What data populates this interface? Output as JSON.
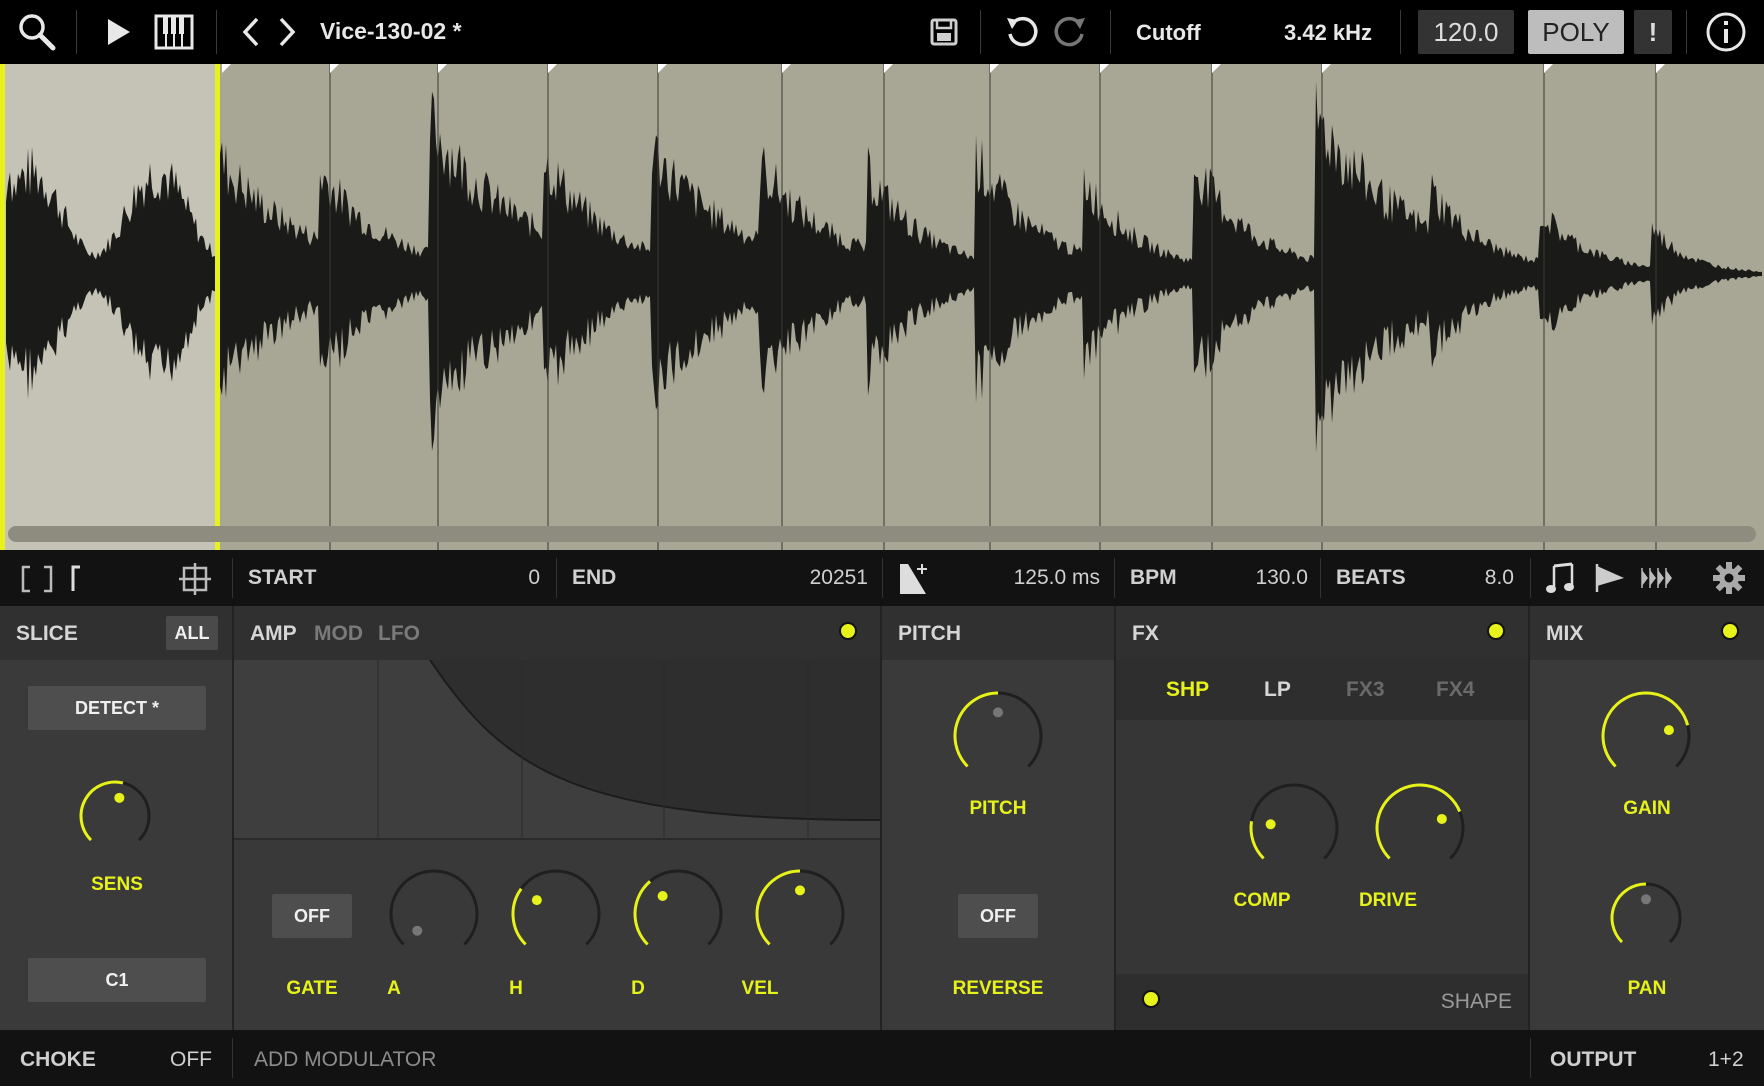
{
  "topbar": {
    "preset_name": "Vice-130-02 *",
    "param_name": "Cutoff",
    "param_value": "3.42 kHz",
    "tempo": "120.0",
    "mode": "POLY",
    "alert": "!",
    "icons": [
      "search-icon",
      "play-icon",
      "keyboard-icon",
      "chevron-left-icon",
      "chevron-right-icon",
      "save-icon",
      "undo-icon",
      "redo-icon",
      "info-icon"
    ]
  },
  "controls": {
    "start_label": "START",
    "start_value": "0",
    "end_label": "END",
    "end_value": "20251",
    "length_value": "125.0 ms",
    "bpm_label": "BPM",
    "bpm_value": "130.0",
    "beats_label": "BEATS",
    "beats_value": "8.0"
  },
  "slice": {
    "title": "SLICE",
    "all": "ALL",
    "detect": "DETECT *",
    "sens_label": "SENS",
    "note": "C1",
    "sens_level": 0.55
  },
  "amp": {
    "tabs": [
      "AMP",
      "MOD",
      "LFO"
    ],
    "gate_button": "OFF",
    "knobs": [
      {
        "label": "GATE"
      },
      {
        "label": "A",
        "level": 0.0
      },
      {
        "label": "H",
        "level": 0.3
      },
      {
        "label": "D",
        "level": 0.35
      },
      {
        "label": "VEL",
        "level": 0.5
      }
    ]
  },
  "pitch": {
    "title": "PITCH",
    "pitch_label": "PITCH",
    "reverse_button": "OFF",
    "reverse_label": "REVERSE",
    "pitch_level": 0.5
  },
  "fx": {
    "title": "FX",
    "tabs": [
      "SHP",
      "LP",
      "FX3",
      "FX4"
    ],
    "comp_label": "COMP",
    "comp_level": 0.2,
    "drive_label": "DRIVE",
    "drive_level": 0.75,
    "shape_label": "SHAPE"
  },
  "mix": {
    "title": "MIX",
    "gain_label": "GAIN",
    "gain_level": 0.78,
    "pan_label": "PAN",
    "pan_level": 0.5
  },
  "bottom": {
    "choke_label": "CHOKE",
    "choke_value": "OFF",
    "add_modulator": "ADD MODULATOR",
    "output_label": "OUTPUT",
    "output_value": "1+2"
  },
  "colors": {
    "accent": "#e6f21a",
    "wave_bg": "#a8a796",
    "wave_selected_bg": "#c4c3b6",
    "panel": "#3a3a3a"
  }
}
